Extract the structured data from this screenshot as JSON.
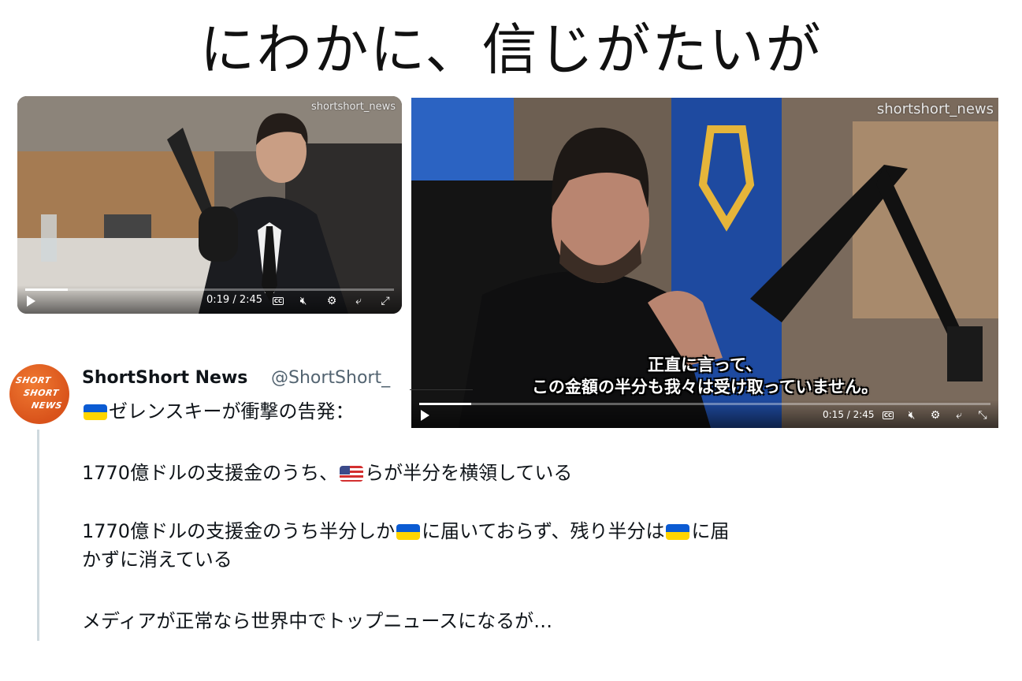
{
  "headline": "にわかに、信じがたいが",
  "video_left": {
    "watermark": "shortshort_news",
    "time": "0:19 / 2:45",
    "progress": 0.115,
    "icons": [
      "play-icon",
      "cc-icon",
      "mute-icon",
      "settings-icon",
      "picture-in-picture-icon",
      "fullscreen-icon"
    ],
    "cc_label": "CC"
  },
  "video_right": {
    "watermark": "shortshort_news",
    "subtitle_line1": "正直に言って、",
    "subtitle_line2": "この金額の半分も我々は受け取っていません。",
    "time": "0:15 / 2:45",
    "progress": 0.091,
    "icons": [
      "play-icon",
      "cc-icon",
      "mute-icon",
      "settings-icon",
      "picture-in-picture-icon",
      "exit-fullscreen-icon"
    ],
    "cc_label": "CC"
  },
  "tweet": {
    "avatar_lines": [
      "SHORT",
      "SHORT",
      "NEWS"
    ],
    "author_name": "ShortShort News",
    "author_handle": "@ShortShort_",
    "intro": "ゼレンスキーが衝撃の告発：",
    "paragraph1_a": "1770億ドルの支援金のうち、",
    "paragraph1_b": "らが半分を横領している",
    "paragraph2_a": "1770億ドルの支援金のうち半分しか",
    "paragraph2_b": "に届いておらず、残り半分は",
    "paragraph2_c": "に届",
    "paragraph2_d": "かずに消えている",
    "paragraph3": "メディアが正常なら世界中でトップニュースになるが…"
  }
}
